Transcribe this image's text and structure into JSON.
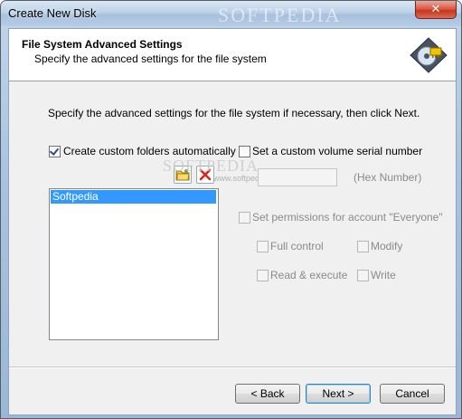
{
  "window": {
    "title": "Create New Disk",
    "watermark": "SOFTPEDIA",
    "close_glyph": "✕"
  },
  "header": {
    "title": "File System Advanced Settings",
    "subtitle": "Specify the advanced settings for the file system"
  },
  "instructions": "Specify the advanced settings for the file system if necessary, then click Next.",
  "custom_folders": {
    "label": "Create custom folders automatically",
    "checked": true,
    "items": [
      "Softpedia"
    ]
  },
  "serial": {
    "label": "Set a custom volume serial number",
    "checked": false,
    "value": "",
    "hint": "(Hex Number)"
  },
  "permissions": {
    "label": "Set permissions for account \"Everyone\"",
    "checked": false,
    "options": {
      "full_control": "Full control",
      "modify": "Modify",
      "read_execute": "Read & execute",
      "write": "Write"
    }
  },
  "watermark_mid": "SOFTPEDIA",
  "watermark_url": "www.softpedia.com",
  "buttons": {
    "back": "< Back",
    "next": "Next >",
    "cancel": "Cancel"
  },
  "icons": {
    "header_logo": "disk-logo-icon",
    "add_folder": "add-folder-icon",
    "delete": "delete-icon"
  }
}
